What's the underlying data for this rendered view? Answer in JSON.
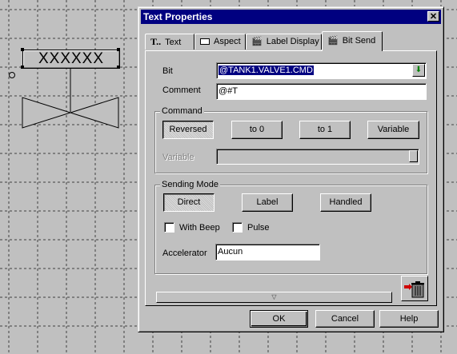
{
  "canvas": {
    "tag_label": "XXXXXX"
  },
  "dialog": {
    "title": "Text Properties",
    "close_glyph": "✕",
    "tabs": [
      {
        "label": "Text",
        "icon_text": "T..",
        "icon": "text-icon"
      },
      {
        "label": "Aspect",
        "icon": "aspect-icon"
      },
      {
        "label": "Label Display",
        "icon": "clapper-icon"
      },
      {
        "label": "Bit Send",
        "icon": "clapper-icon"
      }
    ],
    "bit": {
      "label": "Bit",
      "value": "@TANK1.VALVE1.CMD"
    },
    "comment": {
      "label": "Comment",
      "value": "@#T"
    },
    "command": {
      "title": "Command",
      "buttons": [
        "Reversed",
        "to 0",
        "to 1",
        "Variable"
      ],
      "variable_label": "Variable",
      "variable_value": ""
    },
    "sending_mode": {
      "title": "Sending Mode",
      "buttons": [
        "Direct",
        "Label",
        "Handled"
      ],
      "with_beep": {
        "label": "With Beep",
        "checked": false
      },
      "pulse": {
        "label": "Pulse",
        "checked": false
      },
      "accelerator_label": "Accelerator",
      "accelerator_value": "Aucun"
    },
    "scroll_glyph": "▽",
    "footer": {
      "ok": "OK",
      "cancel": "Cancel",
      "help": "Help"
    }
  },
  "colors": {
    "titlebar": "#000080",
    "selection": "#000080",
    "desktop": "#c0c0c0"
  }
}
